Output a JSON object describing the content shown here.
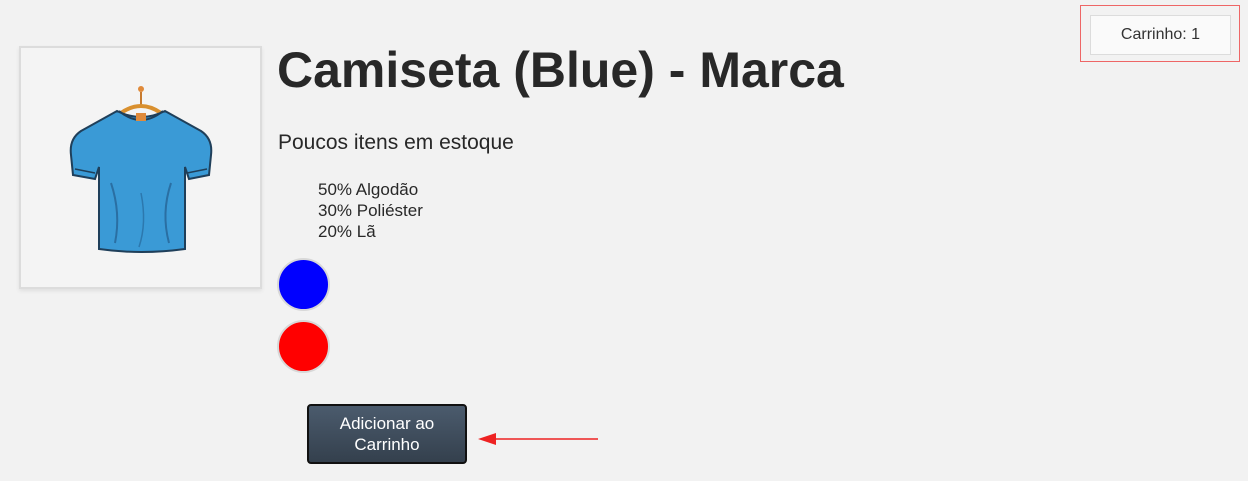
{
  "cart": {
    "label": "Carrinho: 1"
  },
  "product": {
    "image_icon": "tshirt-on-hanger",
    "title": "Camiseta (Blue) - Marca",
    "stock_text": "Poucos itens em estoque",
    "materials": [
      "50% Algodão",
      "30% Poliéster",
      "20% Lã"
    ],
    "colors": [
      {
        "name": "blue",
        "hex": "#0000ff"
      },
      {
        "name": "red",
        "hex": "#ff0000"
      }
    ],
    "add_to_cart_label": "Adicionar ao Carrinho"
  },
  "annotations": {
    "highlight_color": "#ee6666",
    "arrow_color": "#ee2222"
  }
}
